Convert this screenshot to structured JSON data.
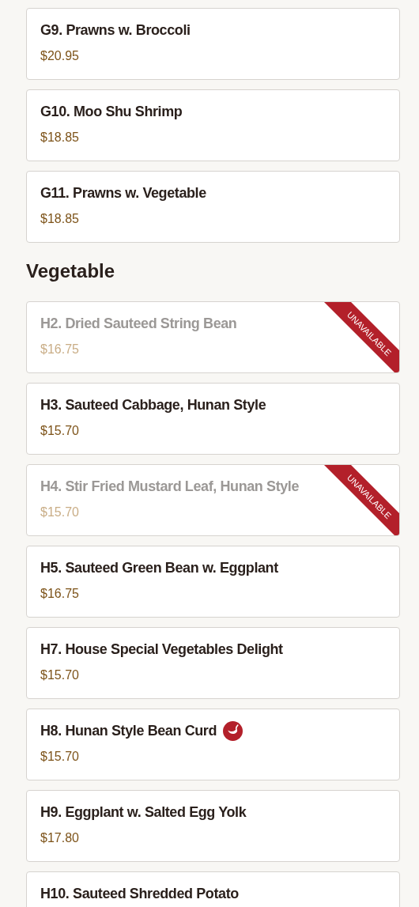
{
  "sections": [
    {
      "items": [
        {
          "name": "G9. Prawns w. Broccoli",
          "price": "$20.95",
          "available": true,
          "spicy": false
        },
        {
          "name": "G10. Moo Shu Shrimp",
          "price": "$18.85",
          "available": true,
          "spicy": false
        },
        {
          "name": "G11. Prawns w. Vegetable",
          "price": "$18.85",
          "available": true,
          "spicy": false
        }
      ]
    },
    {
      "title": "Vegetable",
      "items": [
        {
          "name": "H2. Dried Sauteed String Bean",
          "price": "$16.75",
          "available": false,
          "ribbon": "UNAVAILABLE",
          "spicy": false
        },
        {
          "name": "H3. Sauteed Cabbage, Hunan Style",
          "price": "$15.70",
          "available": true,
          "spicy": false
        },
        {
          "name": "H4. Stir Fried Mustard Leaf, Hunan Style",
          "price": "$15.70",
          "available": false,
          "ribbon": "UNAVAILABLE",
          "spicy": false
        },
        {
          "name": "H5. Sauteed Green Bean w. Eggplant",
          "price": "$16.75",
          "available": true,
          "spicy": false
        },
        {
          "name": "H7. House Special Vegetables Delight",
          "price": "$15.70",
          "available": true,
          "spicy": false
        },
        {
          "name": "H8. Hunan Style Bean Curd",
          "price": "$15.70",
          "available": true,
          "spicy": true
        },
        {
          "name": "H9. Eggplant w. Salted Egg Yolk",
          "price": "$17.80",
          "available": true,
          "spicy": false
        },
        {
          "name": "H10. Sauteed Shredded Potato",
          "available": true,
          "spicy": false
        }
      ]
    }
  ]
}
